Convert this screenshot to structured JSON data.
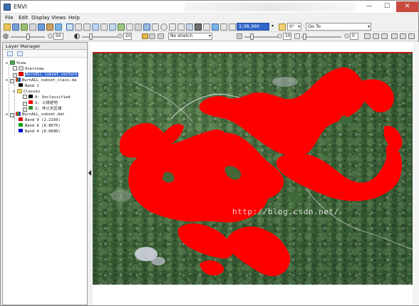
{
  "window": {
    "title": "ENVI"
  },
  "menu": [
    {
      "label": "File"
    },
    {
      "label": "Edit"
    },
    {
      "label": "Display"
    },
    {
      "label": "Views"
    },
    {
      "label": "Help"
    }
  ],
  "toolbar": {
    "scale_value": "1:38,360",
    "rotation_value": "0°",
    "goto_label": "Go To"
  },
  "display_bar": {
    "brightness_value": "50",
    "contrast_value": "20",
    "stretch_value": "No stretch",
    "sharpen_value": "10",
    "transparency_value": "0"
  },
  "layer_manager": {
    "title": "Layer Manager",
    "tree": [
      {
        "label": "View",
        "level": 0
      },
      {
        "label": "Overview",
        "level": 1
      },
      {
        "label": "BurnALL_subset_vectors",
        "level": 1,
        "selected": true
      },
      {
        "label": "BurnALL_subset_class.da",
        "level": 1
      },
      {
        "label": "Band 1",
        "level": 2
      },
      {
        "label": "Classes",
        "level": 2
      },
      {
        "label": "0: Unclassified",
        "level": 3
      },
      {
        "label": "1: 火烧迹地",
        "level": 3
      },
      {
        "label": "2: 非火灾区域",
        "level": 3
      },
      {
        "label": "BurnALL_subset.dat",
        "level": 1
      },
      {
        "label": "Band 9 (2.2150)",
        "level": 2
      },
      {
        "label": "Band 6 (0.8675)",
        "level": 2
      },
      {
        "label": "Band 4 (0.6600)",
        "level": 2
      }
    ]
  },
  "image": {
    "watermark": "http://blog.csdn.net/"
  },
  "colors": {
    "fire": "#ff0000",
    "unclassified": "#000000",
    "non_fire": "#2e8b2e",
    "band_red": "#e00000",
    "band_green": "#00a000",
    "band_blue": "#0000d0",
    "selection": "#3366cc"
  }
}
